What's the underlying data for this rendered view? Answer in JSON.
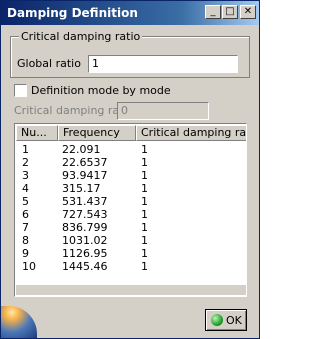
{
  "window": {
    "title": "Damping Definition",
    "minimize_label": "_",
    "maximize_label": "□",
    "close_label": "✕"
  },
  "group": {
    "legend": "Critical damping ratio",
    "global_ratio_label": "Global ratio",
    "global_ratio_value": "1"
  },
  "mode": {
    "checkbox_label": "Definition mode by mode",
    "checked": false,
    "critical_label": "Critical damping ratio",
    "critical_value": "0"
  },
  "table": {
    "columns": [
      "Nu...",
      "Frequency",
      "Critical damping ratio"
    ],
    "rows": [
      [
        "1",
        "22.091",
        "1"
      ],
      [
        "2",
        "22.6537",
        "1"
      ],
      [
        "3",
        "93.9417",
        "1"
      ],
      [
        "4",
        "315.17",
        "1"
      ],
      [
        "5",
        "531.437",
        "1"
      ],
      [
        "6",
        "727.543",
        "1"
      ],
      [
        "7",
        "836.799",
        "1"
      ],
      [
        "8",
        "1031.02",
        "1"
      ],
      [
        "9",
        "1126.95",
        "1"
      ],
      [
        "10",
        "1445.46",
        "1"
      ]
    ]
  },
  "buttons": {
    "ok_label": "OK"
  },
  "icons": {
    "ok": "ok-green-icon",
    "logo": "catia-logo"
  }
}
